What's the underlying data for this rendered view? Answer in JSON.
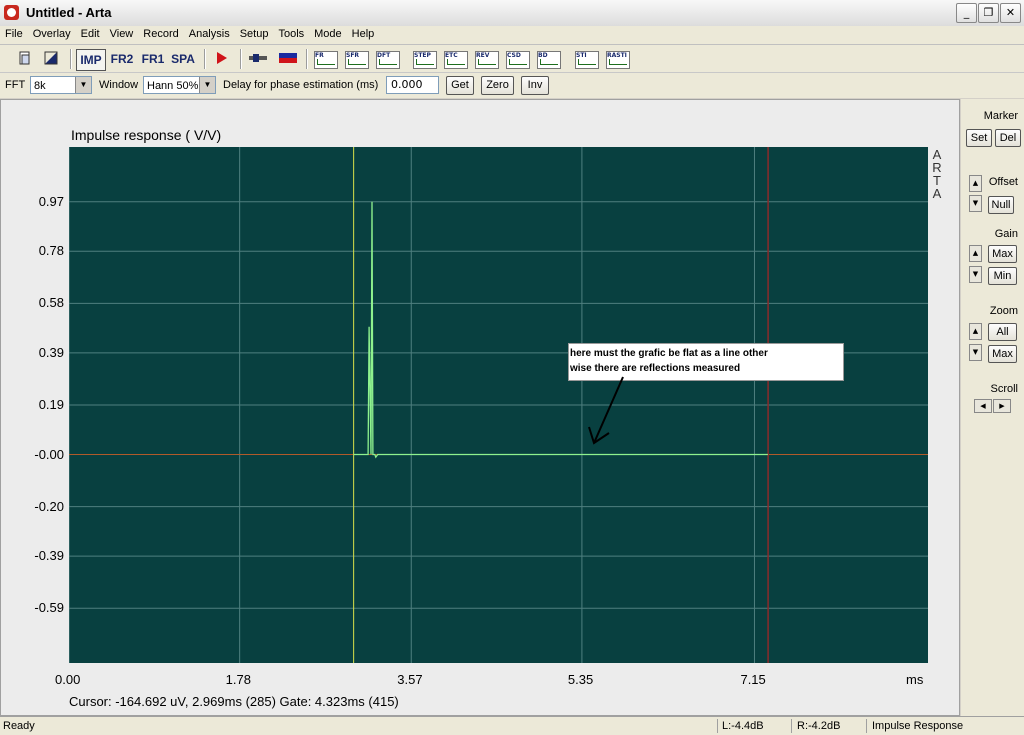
{
  "window": {
    "title": "Untitled - Arta",
    "minimize": "_",
    "maximize": "❐",
    "close": "✕"
  },
  "menu": [
    "File",
    "Overlay",
    "Edit",
    "View",
    "Record",
    "Analysis",
    "Setup",
    "Tools",
    "Mode",
    "Help"
  ],
  "toolbar": {
    "imp": "IMP",
    "fr2": "FR2",
    "fr1": "FR1",
    "spa": "SPA",
    "mini_icons": [
      "FR",
      "SFR",
      "DFT",
      "STEP",
      "ETC",
      "REV",
      "CSD",
      "BD",
      "STI",
      "RASTI"
    ]
  },
  "settings": {
    "fft_label": "FFT",
    "fft_value": "8k",
    "window_label": "Window",
    "window_value": "Hann 50%",
    "delay_label": "Delay for phase estimation (ms)",
    "delay_value": "0.000",
    "get": "Get",
    "zero": "Zero",
    "inv": "Inv"
  },
  "graph": {
    "title": "Impulse response ( V/V)",
    "brand": [
      "A",
      "R",
      "T",
      "A"
    ],
    "cursor_readout": "Cursor: -164.692 uV, 2.969ms (285)  Gate: 4.323ms (415)",
    "annotation": [
      "here must the grafic be flat as a line other",
      "wise there are reflections measured"
    ]
  },
  "chart_data": {
    "type": "line",
    "title": "Impulse response ( V/V)",
    "xlabel": "ms",
    "ylabel": "",
    "xlim": [
      0,
      8.96
    ],
    "ylim": [
      -0.8,
      1.18
    ],
    "x_ticks": [
      "0.00",
      "1.78",
      "3.57",
      "5.35",
      "7.15"
    ],
    "x_tick_values": [
      0.0,
      1.78,
      3.57,
      5.35,
      7.15
    ],
    "x_unit": "ms",
    "y_ticks": [
      "0.97",
      "0.78",
      "0.58",
      "0.39",
      "0.19",
      "-0.00",
      "-0.20",
      "-0.39",
      "-0.59"
    ],
    "y_tick_values": [
      0.97,
      0.78,
      0.58,
      0.39,
      0.19,
      0.0,
      -0.2,
      -0.39,
      -0.59
    ],
    "grid": true,
    "cursor_x": 2.969,
    "gate_x": 7.292,
    "series": [
      {
        "x": [
          2.969,
          3.05,
          3.12,
          3.13,
          3.15,
          3.16,
          3.17,
          3.19,
          3.2,
          3.22,
          7.29
        ],
        "y": [
          0.0,
          0.0,
          0.0,
          0.49,
          0.0,
          0.97,
          0.0,
          0.0,
          -0.01,
          0.0,
          0.0
        ]
      }
    ]
  },
  "side_panel": {
    "marker": "Marker",
    "set": "Set",
    "del": "Del",
    "offset": "Offset",
    "null": "Null",
    "gain": "Gain",
    "max": "Max",
    "min": "Min",
    "zoom": "Zoom",
    "all": "All",
    "zmax": "Max",
    "scroll": "Scroll"
  },
  "status": {
    "ready": "Ready",
    "left": "L:-4.4dB",
    "right": "R:-4.2dB",
    "mode": "Impulse Response"
  },
  "colors": {
    "plot_bg": "#084040",
    "grid": "#4f7f7f",
    "trace": "#8ef28e",
    "cursor": "#d8e04a",
    "gate": "#8a2a2a"
  }
}
